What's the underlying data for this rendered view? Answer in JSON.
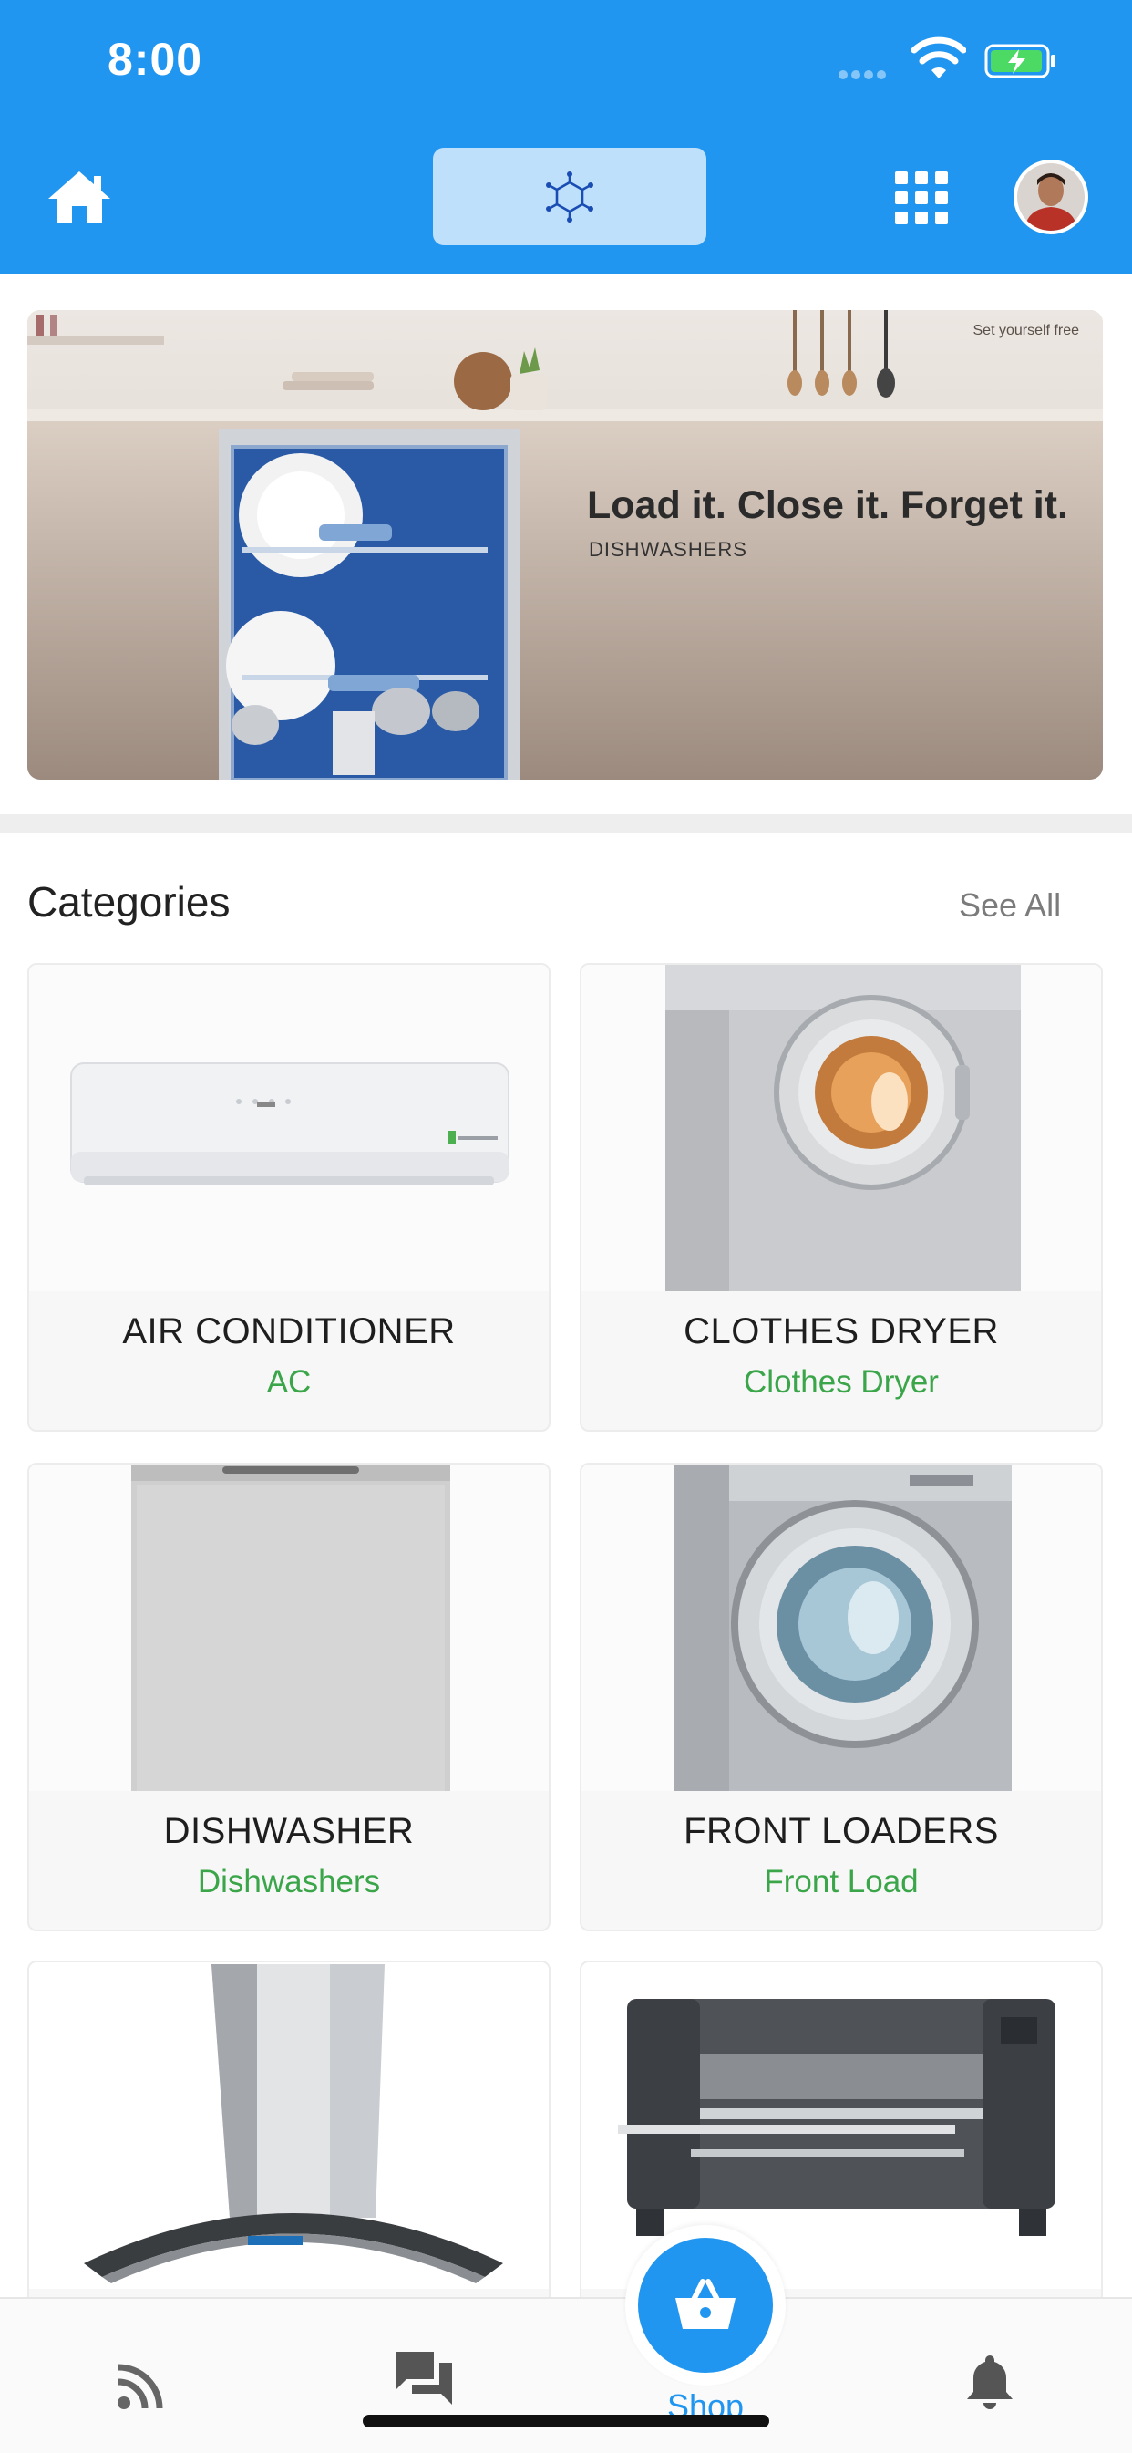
{
  "status_bar": {
    "time": "8:00"
  },
  "header": {
    "home_icon": "home-icon",
    "center_icon": "molecule-icon",
    "grid_icon": "apps-grid-icon",
    "avatar_icon": "user-avatar",
    "accent_color": "#2196f0",
    "center_tab_bg": "#bfe0fb"
  },
  "banner": {
    "title": "Load it. Close it. Forget it.",
    "subtitle": "DISHWASHERS",
    "tag": "Set yourself free"
  },
  "categories": {
    "title": "Categories",
    "see_all": "See All",
    "items": [
      {
        "name": "AIR CONDITIONER",
        "sub": "AC",
        "image": "air-conditioner"
      },
      {
        "name": "CLOTHES DRYER",
        "sub": "Clothes Dryer",
        "image": "clothes-dryer"
      },
      {
        "name": "DISHWASHER",
        "sub": "Dishwashers",
        "image": "dishwasher"
      },
      {
        "name": "FRONT LOADERS",
        "sub": "Front Load",
        "image": "front-loader"
      },
      {
        "name": "",
        "sub": "",
        "image": "chimney-hood"
      },
      {
        "name": "",
        "sub": "",
        "image": "industrial-ironer"
      }
    ],
    "sub_color": "#3aa549"
  },
  "bottom_nav": {
    "items": [
      {
        "icon": "rss-feed-icon"
      },
      {
        "icon": "chat-icon"
      },
      {
        "icon": "basket-icon",
        "label": "Shop"
      },
      {
        "icon": "bell-icon"
      }
    ]
  }
}
